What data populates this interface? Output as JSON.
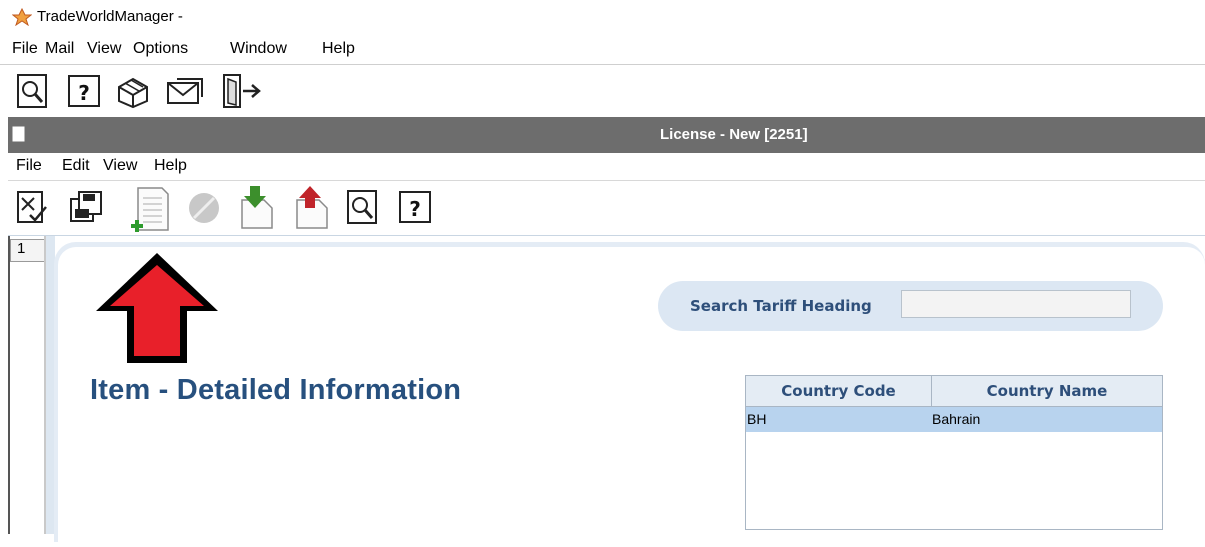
{
  "app": {
    "title": "TradeWorldManager -",
    "menu": [
      "File",
      "Mail",
      "View",
      "Options",
      "Window",
      "Help"
    ],
    "toolbar_icons": [
      "preview-icon",
      "help-icon",
      "modules-icon",
      "mail-icon",
      "exit-icon"
    ]
  },
  "window": {
    "title": "License - New [2251]",
    "menu": [
      "File",
      "Edit",
      "View",
      "Help"
    ],
    "toolbar_icons": [
      "validate-icon",
      "save-icon",
      "new-document-icon",
      "cancel-icon",
      "import-icon",
      "export-icon",
      "preview-icon",
      "help-icon"
    ]
  },
  "page_tab": "1",
  "search": {
    "label": "Search Tariff Heading",
    "value": ""
  },
  "section_title": "Item - Detailed Information",
  "country_table": {
    "columns": [
      "Country Code",
      "Country Name"
    ],
    "rows": [
      [
        "BH",
        "Bahrain"
      ]
    ]
  },
  "colors": {
    "window_titlebar": "#6d6d6d",
    "heading": "#27507e",
    "selected_row": "#b8d3ee",
    "arrow": "#e8202a"
  }
}
